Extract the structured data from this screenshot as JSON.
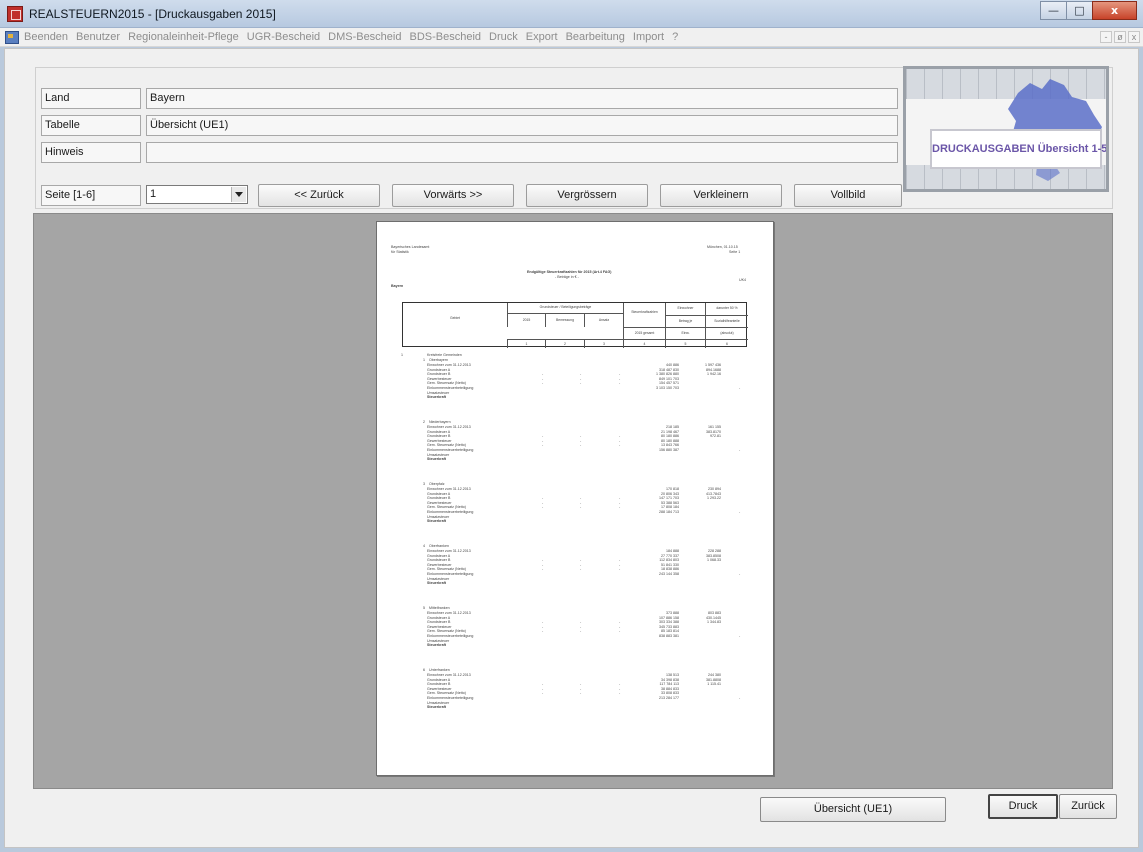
{
  "window": {
    "title": "REALSTEUERN2015 - [Druckausgaben 2015]",
    "btn_min": "—",
    "btn_max": "□",
    "btn_close": "x"
  },
  "menu": {
    "items": [
      "Beenden",
      "Benutzer",
      "Regionaleinheit-Pflege",
      "UGR-Bescheid",
      "DMS-Bescheid",
      "BDS-Bescheid",
      "Druck",
      "Export",
      "Bearbeitung",
      "Import",
      "?"
    ],
    "mdi_min": "-",
    "mdi_restore": "ø",
    "mdi_close": "x"
  },
  "form": {
    "land_label": "Land",
    "land_value": "Bayern",
    "tabelle_label": "Tabelle",
    "tabelle_value": "Übersicht  (UE1)",
    "hinweis_label": "Hinweis",
    "hinweis_value": "",
    "seite_label": "Seite [1-6]",
    "seite_value": "1"
  },
  "nav": {
    "back": "<< Zurück",
    "forward": "Vorwärts >>",
    "zoom_in": "Vergrössern",
    "zoom_out": "Verkleinern",
    "fullscreen": "Vollbild"
  },
  "logo": {
    "label": "DRUCKAUSGABEN Übersicht 1-5"
  },
  "report": {
    "org_line1": "Bayerisches Landesamt",
    "org_line2": "für Statistik",
    "date_line1": "München, 01.10.15",
    "date_line2": "Seite 1",
    "heading_line1": "Endgültige Steuerkraftzahlen für 2015 (Art.4 FAG)",
    "heading_line2": "- Beträge in € -",
    "region": "Bayern",
    "code": "UK4",
    "col_gebiet": "Gebiet",
    "col_group": "Grundsteuer / Beteiligungsbeträge",
    "col_2015": "2015",
    "col_bemessung": "Bemessung",
    "col_ansatz": "Ansatz",
    "col_steuerkraft": "Steuerkraftzahlen",
    "col_steuerkraft_sub": "2015 gesamt",
    "col_einwohner": "Einwohner",
    "col_einwohner_sub": "Betrag je",
    "col_einwohner_sub2": "Einw.",
    "col_darunter": "darunter 50 %",
    "col_darunter_sub": "Sozialhilfeanteile",
    "col_darunter_sub2": "(absolut)",
    "col_nums": [
      "1",
      "2",
      "3",
      "4",
      "5",
      "6"
    ],
    "intro_num": "1",
    "intro": "Kreisfreie Gemeinden",
    "row_labels": [
      "Einwohner zum 31.12.2013",
      "Grundsteuer A",
      "Grundsteuer B",
      "Gewerbesteuer",
      "Gem. Steuersatz (Netto)",
      "Einkommensteuerbeteiligung",
      "Umsatzsteuer",
      "Steuerkraft"
    ],
    "blocks": [
      {
        "num": "1",
        "name": "Oberbayern",
        "vals": [
          "",
          "440 886",
          "318 487 830",
          "1 380 826 880",
          "",
          "849 101 703",
          "154 457 571",
          "3 103 150 703"
        ],
        "side": [
          "1 597 436",
          "",
          "",
          "",
          "",
          "894.1688",
          "",
          "1 942.16"
        ]
      },
      {
        "num": "2",
        "name": "Niederbayern",
        "vals": [
          "",
          "218 185",
          "21 198 467",
          "80 180 886",
          "",
          "80 180 888",
          "13 843 766",
          "156 880 387"
        ],
        "side": [
          "161 155",
          "",
          "",
          "",
          "",
          "383.8170",
          "",
          "972.81"
        ]
      },
      {
        "num": "3",
        "name": "Oberpfalz",
        "vals": [
          "",
          "170 818",
          "20 806 343",
          "147 171 703",
          "",
          "53 388 563",
          "17 808 184",
          "288 184 713"
        ],
        "side": [
          "230 894",
          "",
          "",
          "",
          "",
          "413.7843",
          "",
          "1 293.22"
        ]
      },
      {
        "num": "4",
        "name": "Oberfranken",
        "vals": [
          "",
          "184 888",
          "27 770 337",
          "112 834 803",
          "",
          "51 841 330",
          "18 838 886",
          "243 144 358"
        ],
        "side": [
          "228 288",
          "",
          "",
          "",
          "",
          "383.8508",
          "",
          "1 068.33"
        ]
      },
      {
        "num": "5",
        "name": "Mittelfranken",
        "vals": [
          "",
          "373 888",
          "107 886 158",
          "303 334 388",
          "",
          "345 733 883",
          "85 183 814",
          "838 883 381"
        ],
        "side": [
          "803 883",
          "",
          "",
          "",
          "",
          "430.1445",
          "",
          "1 344.83"
        ]
      },
      {
        "num": "6",
        "name": "Unterfranken",
        "vals": [
          "",
          "138 513",
          "34 398 838",
          "117 784 113",
          "",
          "38 884 833",
          "33 808 833",
          "213 284 177"
        ],
        "side": [
          "244 380",
          "",
          "",
          "",
          "",
          "381.8808",
          "",
          "1 115.41"
        ]
      }
    ],
    "dash": "-"
  },
  "footer": {
    "overview_btn": "Übersicht (UE1)",
    "print_btn": "Druck",
    "back_btn": "Zurück"
  }
}
